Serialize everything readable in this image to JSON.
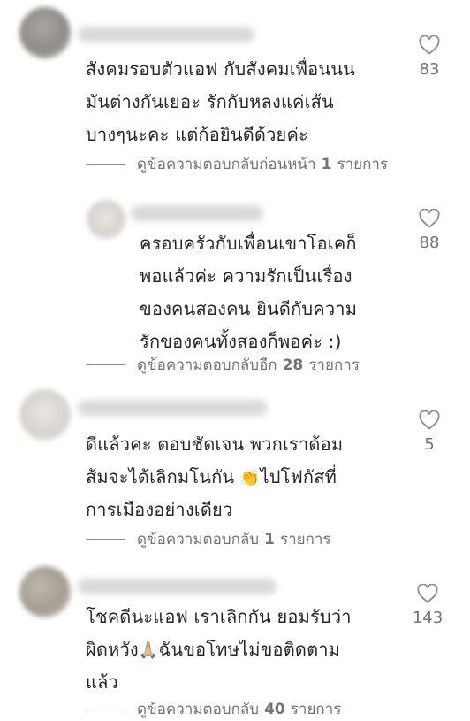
{
  "comments": [
    {
      "lines": [
        "สังคมรอบตัวแอฟ กับสังคมเพื่อนนน",
        "มันต่างกันเยอะ รักกับหลงแค่เส้น",
        "บางๆนะคะ แต่ก้อยินดีด้วยค่ะ"
      ],
      "likes": "83",
      "replies_prefix": "ดูข้อความตอบกลับก่อนหน้า",
      "replies_count": "1",
      "replies_suffix": "รายการ"
    },
    {
      "lines": [
        "ครอบครัวกับเพื่อนเขาโอเคก็",
        "พอแล้วค่ะ ความรักเป็นเรื่อง",
        "ของคนสองคน ยินดีกับความ",
        "รักของคนทั้งสองก็พอค่ะ :)"
      ],
      "likes": "88",
      "replies_prefix": "ดูข้อความตอบกลับอีก",
      "replies_count": "28",
      "replies_suffix": "รายการ"
    },
    {
      "lines": [
        "ดีแล้วคะ ตอบชัดเจน พวกเราด้อม",
        "ส้มจะได้เลิกมโนกัน",
        "ไปโฟกัสที่",
        "การเมืองอย่างเดียว"
      ],
      "emoji": "👏",
      "likes": "5",
      "replies_prefix": "ดูข้อความตอบกลับ",
      "replies_count": "1",
      "replies_suffix": "รายการ"
    },
    {
      "lines": [
        "โชคดีนะแอฟ เราเลิกกัน ยอมรับว่า",
        "ผิดหวัง",
        "ฉันขอโทษไม่ขอติดตาม",
        "แล้ว"
      ],
      "emoji": "🙏🏼",
      "likes": "143",
      "replies_prefix": "ดูข้อความตอบกลับ",
      "replies_count": "40",
      "replies_suffix": "รายการ"
    }
  ]
}
